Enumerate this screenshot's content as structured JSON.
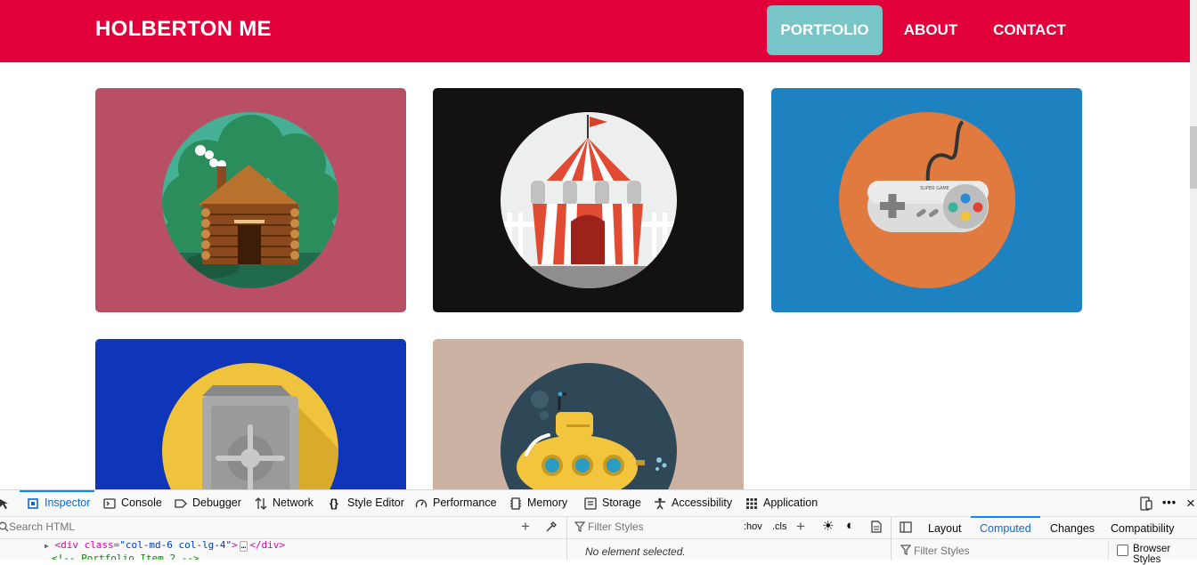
{
  "navbar": {
    "brand": "HOLBERTON ME",
    "items": [
      {
        "label": "PORTFOLIO",
        "active": true
      },
      {
        "label": "ABOUT",
        "active": false
      },
      {
        "label": "CONTACT",
        "active": false
      }
    ],
    "color": "#e2003b",
    "active_color": "#78c5c8"
  },
  "portfolio": {
    "items": [
      {
        "icon": "log-cabin-icon",
        "bg": "#b84f64"
      },
      {
        "icon": "circus-tent-icon",
        "bg": "#141211"
      },
      {
        "icon": "game-controller-icon",
        "bg": "#1e82c1",
        "controller_text": "SUPER GAME"
      },
      {
        "icon": "safe-icon",
        "bg": "#0f35b8"
      },
      {
        "icon": "submarine-icon",
        "bg": "#cbb2a3"
      }
    ]
  },
  "devtools": {
    "tabs": [
      {
        "label": "Inspector",
        "icon": "inspector-icon",
        "active": true
      },
      {
        "label": "Console",
        "icon": "console-icon"
      },
      {
        "label": "Debugger",
        "icon": "debugger-icon"
      },
      {
        "label": "Network",
        "icon": "network-icon"
      },
      {
        "label": "Style Editor",
        "icon": "style-editor-icon"
      },
      {
        "label": "Performance",
        "icon": "performance-icon"
      },
      {
        "label": "Memory",
        "icon": "memory-icon"
      },
      {
        "label": "Storage",
        "icon": "storage-icon"
      },
      {
        "label": "Accessibility",
        "icon": "accessibility-icon"
      },
      {
        "label": "Application",
        "icon": "application-icon"
      }
    ],
    "search_html_placeholder": "Search HTML",
    "filter_styles_placeholder": "Filter Styles",
    "hov": ":hov",
    "cls": ".cls",
    "no_element": "No element selected.",
    "side_tabs": [
      {
        "label": "Layout",
        "active": false
      },
      {
        "label": "Computed",
        "active": true
      },
      {
        "label": "Changes",
        "active": false
      },
      {
        "label": "Compatibility",
        "active": false
      }
    ],
    "filter_styles_2": "Filter Styles",
    "browser_styles": "Browser Styles",
    "markup": {
      "line1_open": "<div class=",
      "line1_class": "\"col-md-6 col-lg-4\"",
      "line1_gt": ">",
      "line1_ellipsis": "…",
      "line1_close": "</div>",
      "line2": "<!-- Portfolio Item 2 -->"
    }
  }
}
